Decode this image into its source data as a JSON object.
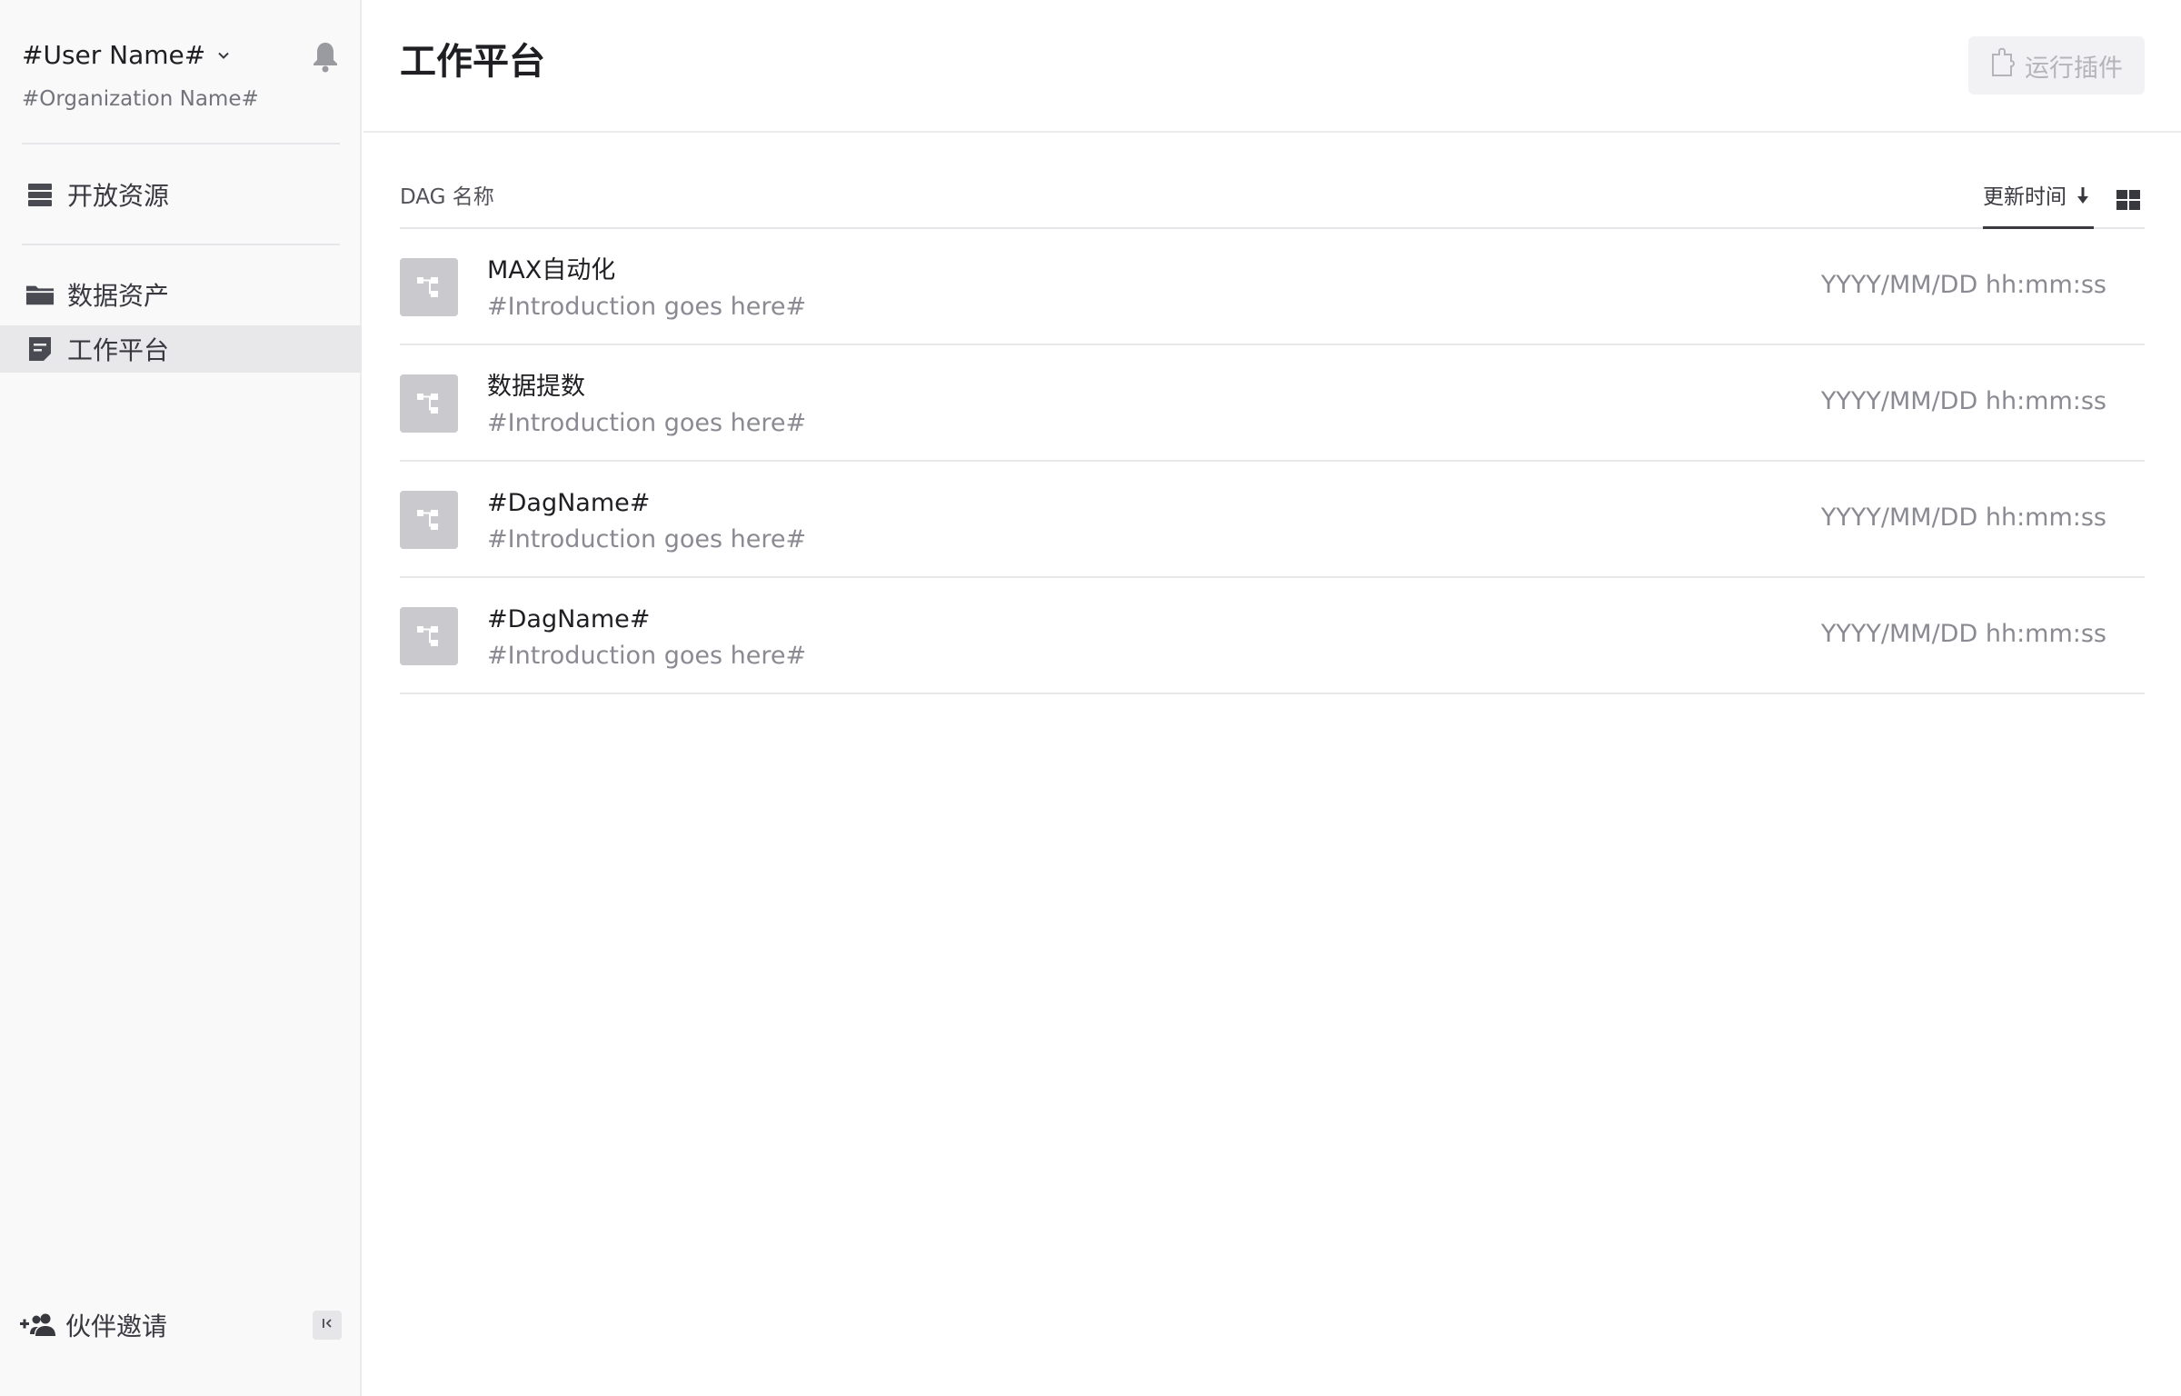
{
  "sidebar": {
    "user_name": "#User Name#",
    "org_name": "#Organization Name#",
    "icons": {
      "dropdown": "chevron-down-icon",
      "notifications": "bell-icon"
    },
    "nav": [
      {
        "label": "开放资源",
        "icon": "list-icon",
        "active": false
      },
      {
        "label": "数据资产",
        "icon": "folder-icon",
        "active": false
      },
      {
        "label": "工作平台",
        "icon": "note-icon",
        "active": true
      }
    ],
    "invite_label": "伙伴邀请",
    "invite_icon": "add-user-icon",
    "collapse_icon": "collapse-sidebar-icon"
  },
  "header": {
    "title": "工作平台",
    "run_plugin_label": "运行插件",
    "run_plugin_icon": "plugin-icon"
  },
  "list": {
    "name_column": "DAG 名称",
    "sort_label": "更新时间",
    "sort_icon": "arrow-down-icon",
    "view_toggle_icon": "grid-view-icon",
    "rows": [
      {
        "name": "MAX自动化",
        "intro": "#Introduction goes here#",
        "time": "YYYY/MM/DD hh:mm:ss"
      },
      {
        "name": "数据提数",
        "intro": "#Introduction goes here#",
        "time": "YYYY/MM/DD hh:mm:ss"
      },
      {
        "name": "#DagName#",
        "intro": "#Introduction goes here#",
        "time": "YYYY/MM/DD hh:mm:ss"
      },
      {
        "name": "#DagName#",
        "intro": "#Introduction goes here#",
        "time": "YYYY/MM/DD hh:mm:ss"
      }
    ]
  },
  "colors": {
    "sidebar_bg": "#f9f9fa",
    "active_nav_bg": "#e8e8eb",
    "thumb_bg": "#c9c9ce",
    "muted_text": "#8a8a92",
    "disabled_button_bg": "#f2f2f4"
  }
}
